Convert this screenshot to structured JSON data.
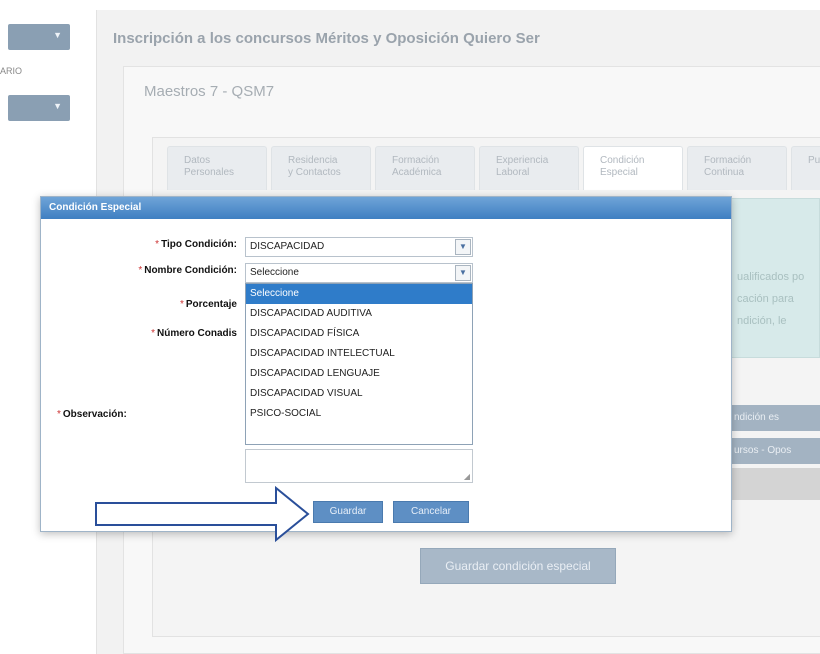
{
  "sidebar": {
    "partial_label": "ARIO",
    "button_arrow": "▼"
  },
  "header": {
    "title": "Inscripción a los concursos Méritos y Oposición Quiero Ser"
  },
  "card": {
    "subtitle": "Maestros 7 - QSM7"
  },
  "tabs": [
    {
      "line1": "Datos",
      "line2": "Personales"
    },
    {
      "line1": "Residencia",
      "line2": "y Contactos"
    },
    {
      "line1": "Formación",
      "line2": "Académica"
    },
    {
      "line1": "Experiencia",
      "line2": "Laboral"
    },
    {
      "line1": "Condición",
      "line2": "Especial"
    },
    {
      "line1": "Formación",
      "line2": "Continua"
    },
    {
      "line1": "Pu",
      "line2": ""
    }
  ],
  "info_box": {
    "line1": "ualificados po",
    "line2": "cación para",
    "line3": "ndición, le"
  },
  "side_buttons": {
    "btn1": "ndición es",
    "btn2": "ursos - Opos"
  },
  "save_special_label": "Guardar condición especial",
  "dialog": {
    "title": "Condición Especial",
    "req": "*",
    "label_tipo": "Tipo Condición:",
    "label_nombre": "Nombre Condición:",
    "label_porcentaje": "Porcentaje",
    "label_numero": "Número Conadis",
    "label_observacion": "Observación:",
    "tipo_value": "DISCAPACIDAD",
    "nombre_value": "Seleccione",
    "dropdown_arrow": "▼",
    "options": [
      "Seleccione",
      "DISCAPACIDAD AUDITIVA",
      "DISCAPACIDAD FÍSICA",
      "DISCAPACIDAD INTELECTUAL",
      "DISCAPACIDAD LENGUAJE",
      "DISCAPACIDAD VISUAL",
      "PSICO-SOCIAL"
    ],
    "selected_option": "Seleccione",
    "guardar_label": "Guardar",
    "cancelar_label": "Cancelar"
  },
  "colors": {
    "dialog_header": "#3f7fc2",
    "selected_option": "#2f7cc9",
    "arrow_stroke": "#2a4f9a"
  }
}
